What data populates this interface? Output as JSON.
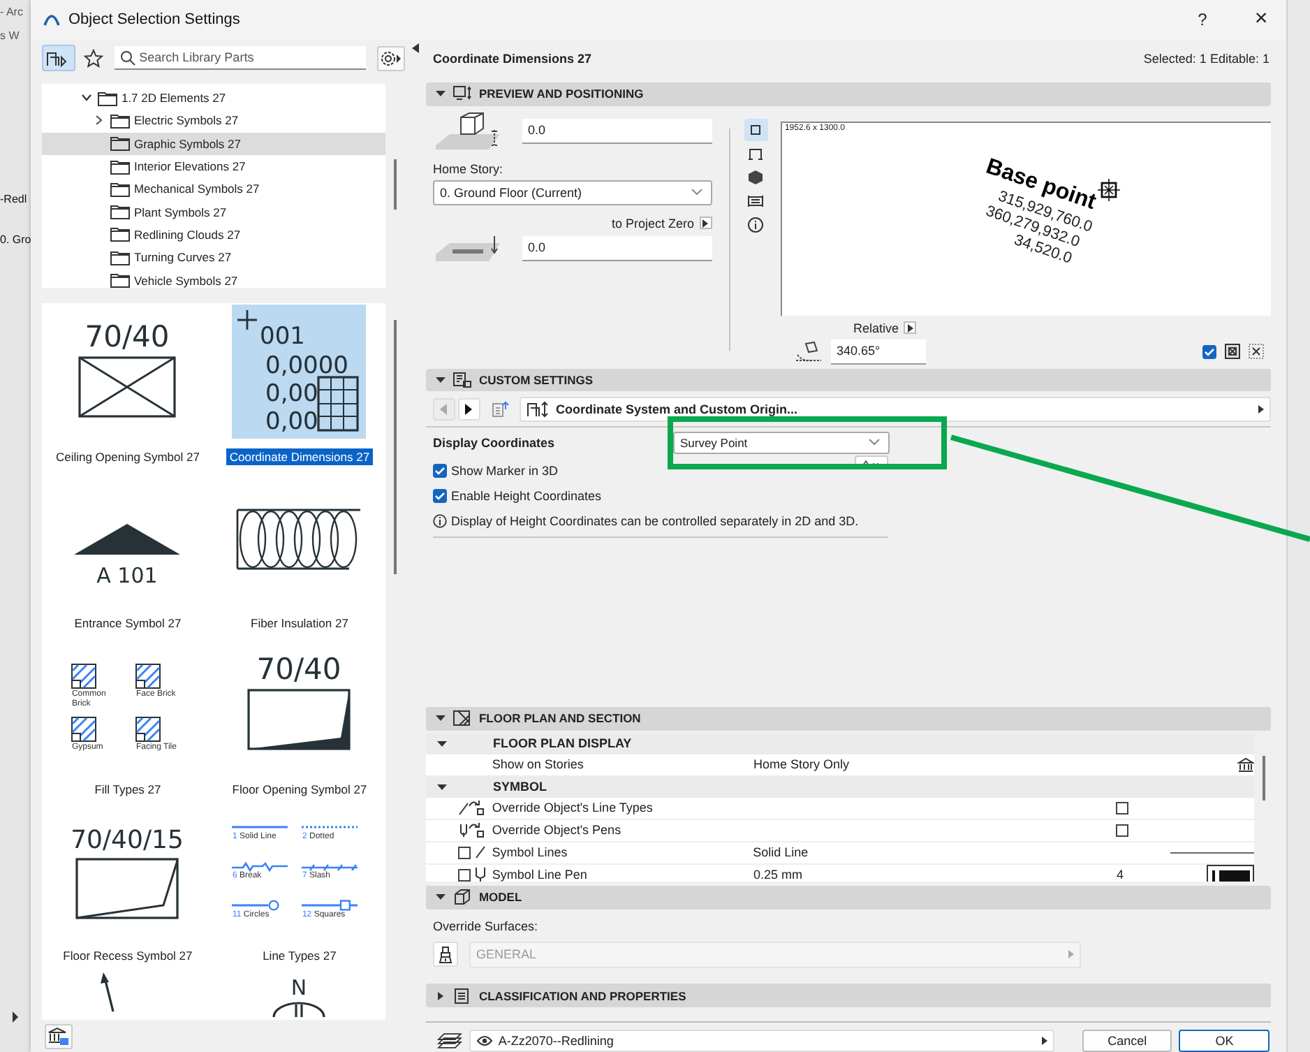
{
  "background_app": {
    "texts": [
      "- Arc",
      "s W",
      "-Redl",
      "0. Gro"
    ]
  },
  "window": {
    "title": "Object Selection Settings",
    "help": "?",
    "close": "×"
  },
  "library": {
    "search": {
      "placeholder": "Search Library Parts"
    },
    "tree": {
      "label": "1.7 2D Elements 27",
      "expanded": true,
      "children": [
        {
          "label": "Electric Symbols 27",
          "kind": "branch",
          "selected": false
        },
        {
          "label": "Graphic Symbols 27",
          "kind": "leaf",
          "selected": true
        },
        {
          "label": "Interior Elevations 27",
          "kind": "leaf",
          "selected": false
        },
        {
          "label": "Mechanical Symbols 27",
          "kind": "leaf",
          "selected": false
        },
        {
          "label": "Plant Symbols 27",
          "kind": "leaf",
          "selected": false
        },
        {
          "label": "Redlining Clouds 27",
          "kind": "leaf",
          "selected": false
        },
        {
          "label": "Turning Curves 27",
          "kind": "leaf",
          "selected": false
        },
        {
          "label": "Vehicle Symbols 27",
          "kind": "leaf",
          "selected": false
        }
      ]
    },
    "parts": [
      {
        "kind": "ceiling",
        "label": "Ceiling Opening Symbol 27",
        "selected": false,
        "texts": [
          "70/40"
        ]
      },
      {
        "kind": "coordinates",
        "label": "Coordinate Dimensions 27",
        "selected": true,
        "texts": [
          "001",
          "0,0000",
          "0,00",
          "0,00"
        ]
      },
      {
        "kind": "entrance",
        "label": "Entrance Symbol 27",
        "selected": false,
        "texts": [
          "A 101"
        ]
      },
      {
        "kind": "insulation",
        "label": "Fiber Insulation 27",
        "selected": false
      },
      {
        "kind": "fills",
        "label": "Fill Types 27",
        "selected": false,
        "texts": [
          "Common Brick",
          "Face Brick",
          "Gypsum",
          "Facing Tile"
        ]
      },
      {
        "kind": "floor_opening",
        "label": "Floor Opening Symbol 27",
        "selected": false,
        "texts": [
          "70/40"
        ]
      },
      {
        "kind": "floor_recess",
        "label": "Floor Recess Symbol 27",
        "selected": false,
        "texts": [
          "70/40/15"
        ]
      },
      {
        "kind": "line_types",
        "label": "Line Types 27",
        "selected": false,
        "samples": [
          {
            "number": "1",
            "name": "Solid Line"
          },
          {
            "number": "2",
            "name": "Dotted"
          },
          {
            "number": "6",
            "name": "Break"
          },
          {
            "number": "7",
            "name": "Slash"
          },
          {
            "number": "11",
            "name": "Circles"
          },
          {
            "number": "12",
            "name": "Squares"
          }
        ]
      },
      {
        "kind": "arrow",
        "selected": false
      },
      {
        "kind": "compass",
        "selected": false,
        "texts": [
          "N"
        ]
      }
    ]
  },
  "selection": {
    "title": "Coordinate Dimensions 27",
    "summary": "Selected: 1 Editable: 1"
  },
  "sections": [
    {
      "kind": "preview",
      "title": "PREVIEW AND POSITIONING",
      "expanded": true,
      "elevation": "0.0",
      "home_story_label": "Home Story:",
      "home_story": "0. Ground Floor (Current)",
      "reference": "to Project Zero",
      "project_elevation": "0.0",
      "views": [
        {
          "kind": "plan",
          "selected": true
        },
        {
          "kind": "section",
          "selected": false
        },
        {
          "kind": "model",
          "selected": false
        },
        {
          "kind": "elevation",
          "selected": false
        },
        {
          "kind": "info",
          "selected": false
        }
      ],
      "preview": {
        "size": "1952.6 x 1300.0",
        "heading": "Base point",
        "lines": [
          "315,929,760.0",
          "360,279,932.0",
          "34,520.0"
        ]
      },
      "angle_reference": "Relative",
      "angle": "340.65°",
      "mirror_checked": true
    },
    {
      "kind": "custom",
      "title": "CUSTOM SETTINGS",
      "expanded": true,
      "page": "Coordinate System and Custom Origin...",
      "display_label": "Display Coordinates",
      "display_value": "Survey Point",
      "options": [
        {
          "label": "Show Marker in 3D",
          "checked": true
        },
        {
          "label": "Enable Height Coordinates",
          "checked": true
        }
      ],
      "note": "Display of Height Coordinates can be controlled separately in 2D and 3D."
    },
    {
      "kind": "table",
      "title": "FLOOR PLAN AND SECTION",
      "expanded": true,
      "groups": [
        {
          "title": "FLOOR PLAN DISPLAY",
          "expanded": true,
          "rows": [
            {
              "kind": "stories",
              "label": "Show on Stories",
              "value": "Home Story Only"
            }
          ]
        },
        {
          "title": "SYMBOL",
          "expanded": true,
          "rows": [
            {
              "kind": "override_lines",
              "label": "Override Object's Line Types",
              "checked": false
            },
            {
              "kind": "override_pens",
              "label": "Override Object's Pens",
              "checked": false
            },
            {
              "kind": "lines",
              "label": "Symbol Lines",
              "value": "Solid Line",
              "checked": false
            },
            {
              "kind": "pen",
              "label": "Symbol Line Pen",
              "value": "0.25 mm",
              "pen": "4",
              "checked": false
            }
          ]
        }
      ]
    },
    {
      "kind": "model",
      "title": "MODEL",
      "expanded": true,
      "label": "Override Surfaces:",
      "surface": "GENERAL",
      "surface_disabled": true
    },
    {
      "kind": "classification",
      "title": "CLASSIFICATION AND PROPERTIES",
      "expanded": false
    }
  ],
  "footer": {
    "layer": "A-Zz2070--Redlining",
    "cancel": "Cancel",
    "ok": "OK"
  }
}
